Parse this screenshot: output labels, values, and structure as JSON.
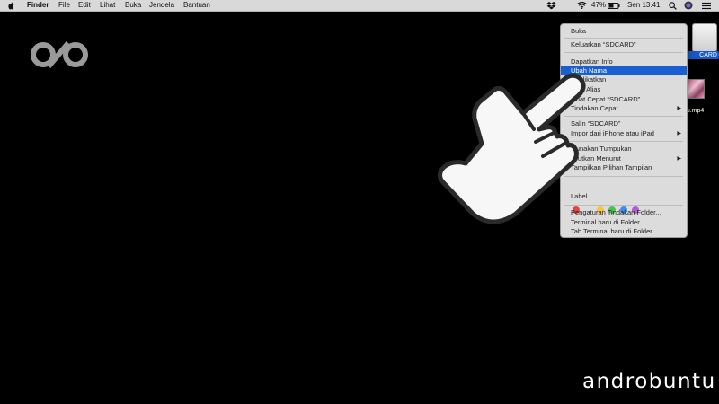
{
  "menubar": {
    "app_name": "Finder",
    "menus": [
      "File",
      "Edit",
      "Lihat",
      "Buka",
      "Jendela",
      "Bantuan"
    ],
    "battery": "47%",
    "clock": "Sen 13.41",
    "icons": [
      "apple-icon",
      "dropbox-icon",
      "wifi-icon",
      "battery-icon",
      "search-icon",
      "siri-icon",
      "notification-icon"
    ]
  },
  "desktop": {
    "drive_label": "CARD",
    "file_label": "ntu.mp4"
  },
  "context_menu": {
    "items": [
      "Buka",
      "Keluarkan “SDCARD”",
      "Dapatkan Info",
      "Ubah Nama",
      "Duplikatkan",
      "Buat Alias",
      "Lihat Cepat “SDCARD”",
      "Tindakan Cepat",
      "Salin “SDCARD”",
      "Impor dari iPhone atau iPad",
      "Gunakan Tumpukan",
      "Urutkan Menurut",
      "Tampilkan Pilihan Tampilan",
      "Label...",
      "Pengaturan Tindakan Folder...",
      "Terminal baru di Folder",
      "Tab Terminal baru di Folder"
    ],
    "highlighted": "Ubah Nama",
    "tag_colors": [
      "#e4473e",
      "#f5c542",
      "#4fc34f",
      "#3a8ef0",
      "#b45ccf"
    ],
    "submenu_arrow": "▶"
  },
  "watermark": "androbuntu",
  "colors": {
    "highlight": "#1a5fd1",
    "menubar": "#d9d9d9"
  }
}
